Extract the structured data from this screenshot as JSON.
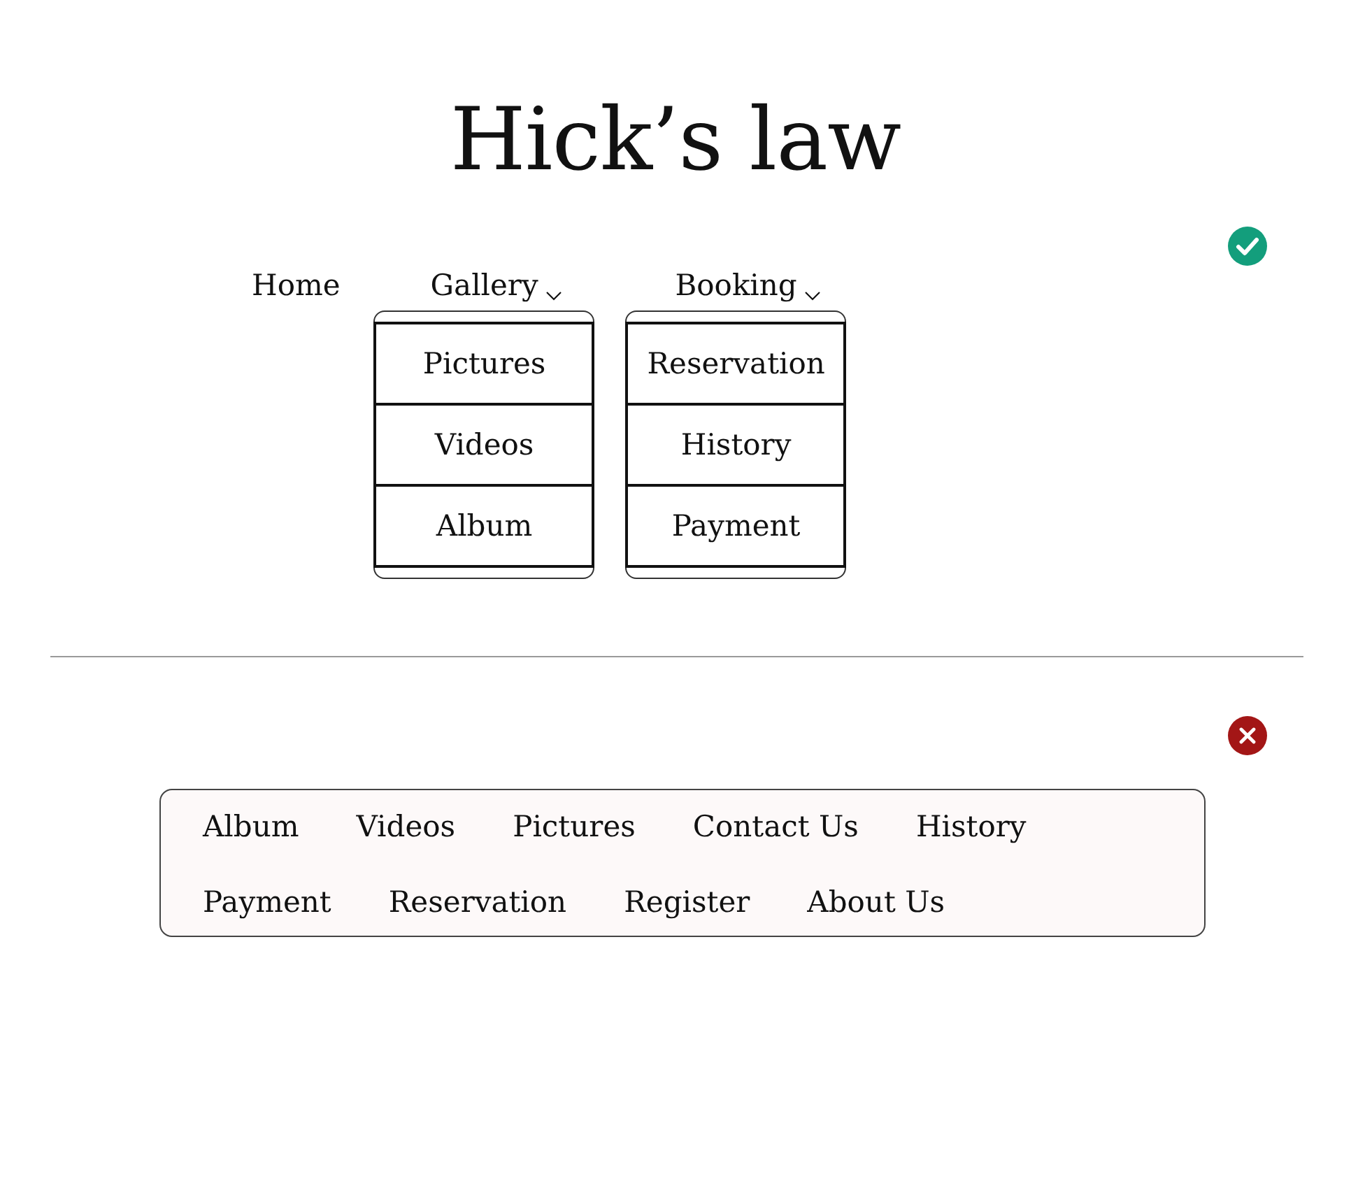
{
  "title": "Hick’s law",
  "examples": [
    {
      "correct": true,
      "kind": "dropdowns",
      "nav": [
        {
          "label": "Home",
          "kind": "link"
        },
        {
          "label": "Gallery",
          "kind": "dropdown",
          "expanded": true,
          "children": [
            {
              "label": "Pictures"
            },
            {
              "label": "Videos"
            },
            {
              "label": "Album"
            }
          ]
        },
        {
          "label": "Booking",
          "kind": "dropdown",
          "expanded": true,
          "children": [
            {
              "label": "Reservation"
            },
            {
              "label": "History"
            },
            {
              "label": "Payment"
            }
          ]
        }
      ]
    },
    {
      "correct": false,
      "kind": "flat",
      "nav": [
        {
          "label": "Album",
          "kind": "link"
        },
        {
          "label": "Videos",
          "kind": "link"
        },
        {
          "label": "Pictures",
          "kind": "link"
        },
        {
          "label": "Contact Us",
          "kind": "link"
        },
        {
          "label": "History",
          "kind": "link"
        },
        {
          "label": "Payment",
          "kind": "link"
        },
        {
          "label": "Reservation",
          "kind": "link"
        },
        {
          "label": "Register",
          "kind": "link"
        },
        {
          "label": "About Us",
          "kind": "link"
        }
      ]
    }
  ]
}
